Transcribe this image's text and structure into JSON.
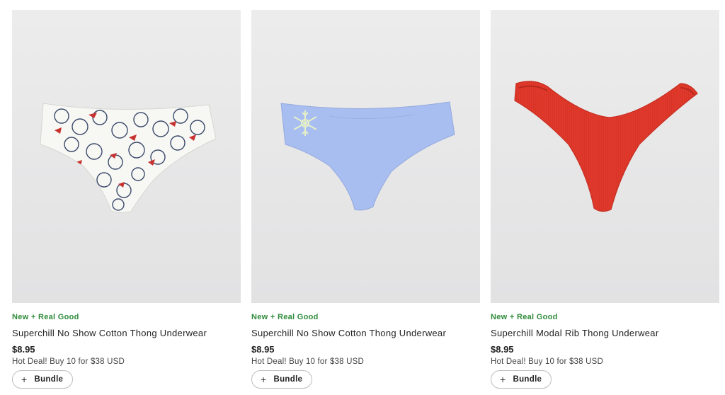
{
  "products": [
    {
      "badge": "New + Real Good",
      "name": "Superchill No Show Cotton Thong Underwear",
      "price": "$8.95",
      "deal": "Hot Deal! Buy 10 for $38 USD",
      "bundle_label": "Bundle",
      "bundle_icon": "plus-icon",
      "image_subject": "white-thong-polar-bear-print",
      "colors": {
        "fabric": "#f7f7f4",
        "print_line": "#3b4a6b",
        "print_accent": "#c8322e"
      }
    },
    {
      "badge": "New + Real Good",
      "name": "Superchill No Show Cotton Thong Underwear",
      "price": "$8.95",
      "deal": "Hot Deal! Buy 10 for $38 USD",
      "bundle_label": "Bundle",
      "bundle_icon": "plus-icon",
      "image_subject": "periwinkle-thong-snowflake",
      "colors": {
        "fabric": "#a8bdf0",
        "print_accent": "#e6f0c8"
      }
    },
    {
      "badge": "New + Real Good",
      "name": "Superchill Modal Rib Thong Underwear",
      "price": "$8.95",
      "deal": "Hot Deal! Buy 10 for $38 USD",
      "bundle_label": "Bundle",
      "bundle_icon": "plus-icon",
      "image_subject": "red-ribbed-high-cut-thong",
      "colors": {
        "fabric": "#e0392b"
      }
    }
  ],
  "theme": {
    "badge_color": "#2e8b3a",
    "photo_bg": "#e9e9ea"
  }
}
